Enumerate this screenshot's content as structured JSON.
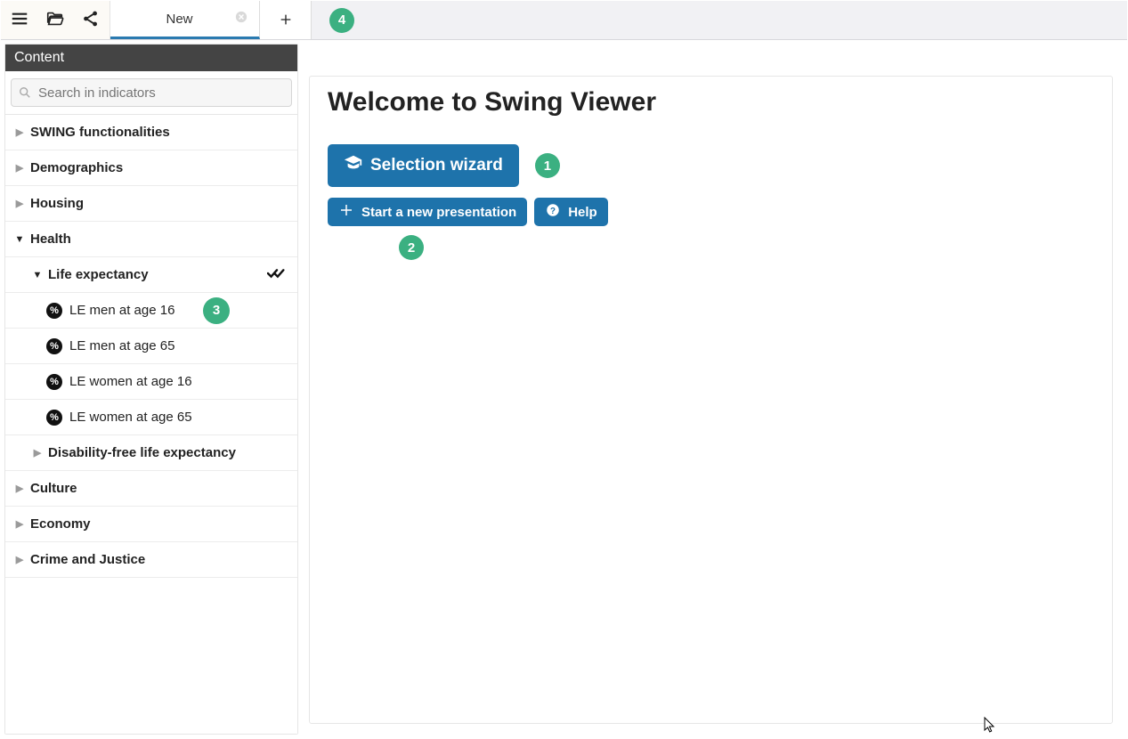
{
  "topbar": {
    "tab_label": "New",
    "callout": "4"
  },
  "sidebar": {
    "title": "Content",
    "search_placeholder": "Search in indicators",
    "callout_3": "3",
    "nodes": {
      "swing_func": "SWING functionalities",
      "demographics": "Demographics",
      "housing": "Housing",
      "health": "Health",
      "life_exp": "Life expectancy",
      "le_men_16": "LE men at age 16",
      "le_men_65": "LE men at age 65",
      "le_women_16": "LE women at age 16",
      "le_women_65": "LE women at age 65",
      "dfle": "Disability-free life expectancy",
      "culture": "Culture",
      "economy": "Economy",
      "crime": "Crime and Justice"
    }
  },
  "main": {
    "heading": "Welcome to Swing Viewer",
    "wizard_label": "Selection wizard",
    "callout_1": "1",
    "start_label": "Start a new presentation",
    "help_label": "Help",
    "callout_2": "2"
  }
}
